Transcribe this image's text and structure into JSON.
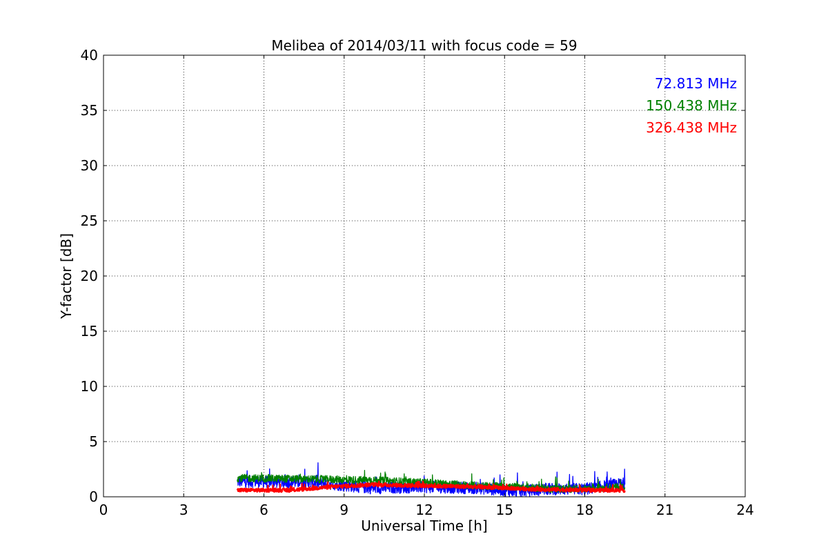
{
  "chart_data": {
    "type": "line",
    "title": "Melibea of 2014/03/11 with focus code = 59",
    "xlabel": "Universal Time [h]",
    "ylabel": "Y-factor [dB]",
    "xlim": [
      0,
      24
    ],
    "ylim": [
      0,
      40
    ],
    "xticks": [
      0,
      3,
      6,
      9,
      12,
      15,
      18,
      21,
      24
    ],
    "yticks": [
      0,
      5,
      10,
      15,
      20,
      25,
      30,
      35,
      40
    ],
    "xtick_labels": [
      "0",
      "3",
      "6",
      "9",
      "12",
      "15",
      "18",
      "21",
      "24"
    ],
    "ytick_labels": [
      "0",
      "5",
      "10",
      "15",
      "20",
      "25",
      "30",
      "35",
      "40"
    ],
    "grid": true,
    "legend_placement": "top-right",
    "series": [
      {
        "name": "72.813 MHz",
        "color": "#0000ff",
        "x_start": 5.0,
        "x_end": 19.5,
        "baseline": [
          [
            5.0,
            1.4
          ],
          [
            8.0,
            1.3
          ],
          [
            10.0,
            0.8
          ],
          [
            12.0,
            0.9
          ],
          [
            14.0,
            0.8
          ],
          [
            15.5,
            0.5
          ],
          [
            16.5,
            0.7
          ],
          [
            18.0,
            0.7
          ],
          [
            19.5,
            1.2
          ]
        ],
        "band_min": 0.0,
        "band_max": 3.1
      },
      {
        "name": "150.438 MHz",
        "color": "#008000",
        "x_start": 5.0,
        "x_end": 19.5,
        "baseline": [
          [
            5.0,
            1.7
          ],
          [
            8.0,
            1.6
          ],
          [
            10.0,
            1.5
          ],
          [
            12.0,
            1.3
          ],
          [
            14.0,
            1.0
          ],
          [
            15.5,
            0.9
          ],
          [
            17.0,
            0.7
          ],
          [
            18.5,
            0.8
          ],
          [
            19.5,
            0.9
          ]
        ],
        "band_min": 0.2,
        "band_max": 2.4
      },
      {
        "name": "326.438 MHz",
        "color": "#ff0000",
        "x_start": 5.0,
        "x_end": 19.5,
        "baseline": [
          [
            5.0,
            0.6
          ],
          [
            7.0,
            0.6
          ],
          [
            8.5,
            0.9
          ],
          [
            10.0,
            1.1
          ],
          [
            12.0,
            1.0
          ],
          [
            14.0,
            0.9
          ],
          [
            16.0,
            0.7
          ],
          [
            18.0,
            0.6
          ],
          [
            19.5,
            0.6
          ]
        ],
        "band_min": 0.2,
        "band_max": 1.4
      }
    ]
  }
}
